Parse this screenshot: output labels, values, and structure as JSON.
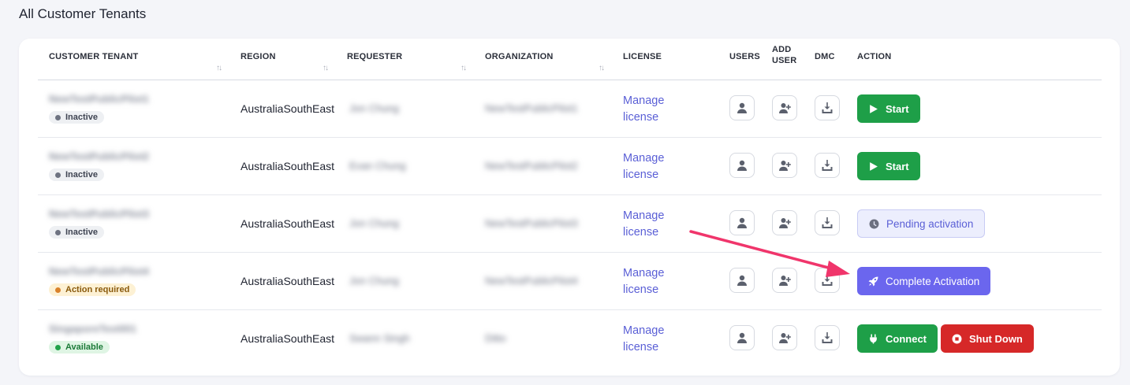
{
  "page": {
    "title": "All Customer Tenants"
  },
  "table": {
    "headers": {
      "tenant": "CUSTOMER TENANT",
      "region": "REGION",
      "requester": "REQUESTER",
      "organization": "ORGANIZATION",
      "license": "LICENSE",
      "users": "USERS",
      "add_user_1": "ADD",
      "add_user_2": "USER",
      "dmc": "DMC",
      "action": "ACTION"
    },
    "sort_icon": "↑↓",
    "rows": [
      {
        "tenant": "NewTestPublicPilot1",
        "status": "Inactive",
        "region": "AustraliaSouthEast",
        "requester": "Jon Chung",
        "organization": "NewTestPublicPilot1",
        "license": "Manage license",
        "actions": [
          "Start"
        ]
      },
      {
        "tenant": "NewTestPublicPilot2",
        "status": "Inactive",
        "region": "AustraliaSouthEast",
        "requester": "Evan Chung",
        "organization": "NewTestPublicPilot2",
        "license": "Manage license",
        "actions": [
          "Start"
        ]
      },
      {
        "tenant": "NewTestPublicPilot3",
        "status": "Inactive",
        "region": "AustraliaSouthEast",
        "requester": "Jon Chung",
        "organization": "NewTestPublicPilot3",
        "license": "Manage license",
        "actions": [
          "Pending activation"
        ]
      },
      {
        "tenant": "NewTestPublicPilot4",
        "status": "Action required",
        "region": "AustraliaSouthEast",
        "requester": "Jon Chung",
        "organization": "NewTestPublicPilot4",
        "license": "Manage license",
        "actions": [
          "Complete Activation"
        ]
      },
      {
        "tenant": "SingaporeTest001",
        "status": "Available",
        "region": "AustraliaSouthEast",
        "requester": "Swann Singh",
        "organization": "Ditto",
        "license": "Manage license",
        "actions": [
          "Connect",
          "Shut Down"
        ]
      }
    ]
  },
  "icons": {
    "users": "user-icon",
    "add_user": "user-plus-icon",
    "dmc": "download-tray-icon",
    "start": "play-icon",
    "pending": "clock-icon",
    "complete": "rocket-icon",
    "connect": "plug-icon",
    "shutdown": "stop-circle-icon"
  },
  "colors": {
    "accent": "#5a5fd6",
    "start_green": "#1e9f48",
    "shutdown_red": "#d62828",
    "complete_purple": "#6b66ee",
    "annotation_arrow": "#f0356b"
  }
}
